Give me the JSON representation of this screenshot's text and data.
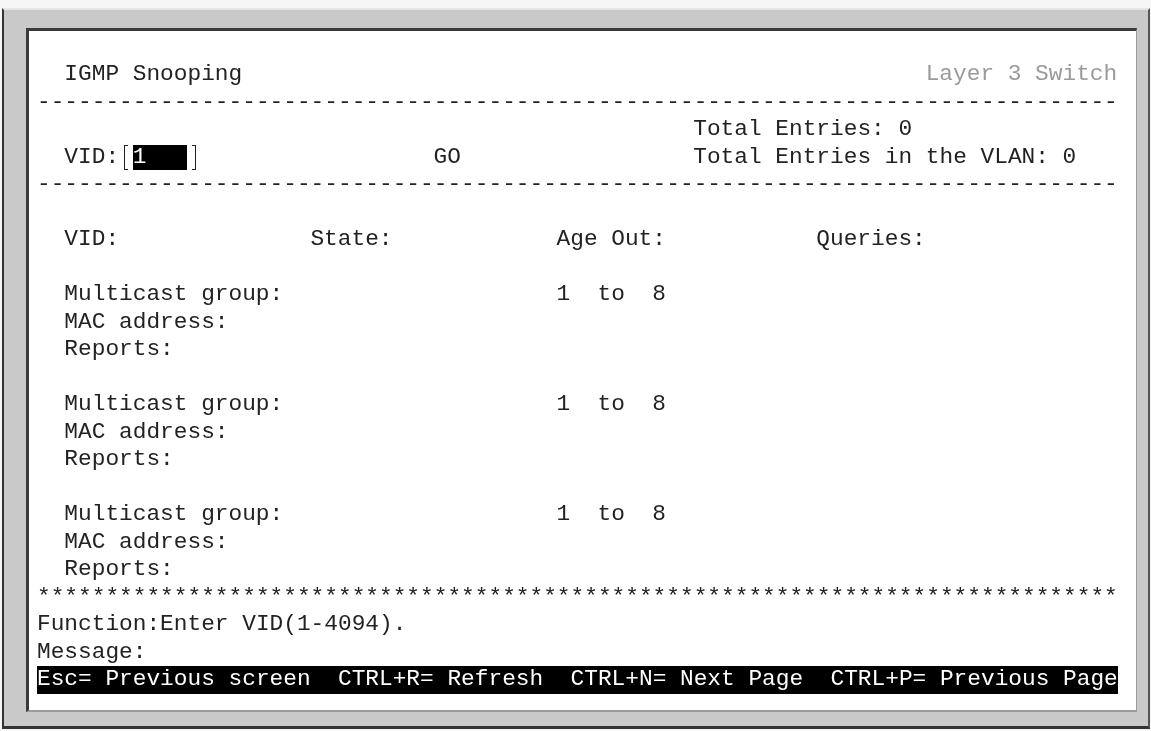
{
  "header": {
    "title": "IGMP Snooping",
    "device": "Layer 3 Switch"
  },
  "rule_top": "-------------------------------------------------------------------------------",
  "totals": [
    "Total Entries: 0",
    "Total Entries in the VLAN: 0"
  ],
  "vid_input": {
    "label": "VID:",
    "value": "1",
    "focused": true
  },
  "go_button": "GO",
  "rule_middle": "-------------------------------------------------------------------------------",
  "columns": [
    "VID:",
    "State:",
    "Age Out:",
    "Queries:"
  ],
  "groups": [
    {
      "group_label": "Multicast group:",
      "range": "1  to  8",
      "mac_label": "MAC address:",
      "reports_label": "Reports:"
    },
    {
      "group_label": "Multicast group:",
      "range": "1  to  8",
      "mac_label": "MAC address:",
      "reports_label": "Reports:"
    },
    {
      "group_label": "Multicast group:",
      "range": "1  to  8",
      "mac_label": "MAC address:",
      "reports_label": "Reports:"
    }
  ],
  "rule_bottom": "*******************************************************************************",
  "function_line": "Function:Enter VID(1-4094).",
  "message_label": "Message:",
  "shortcuts": [
    "Esc= Previous screen",
    "CTRL+R= Refresh",
    "CTRL+N= Next Page",
    "CTRL+P= Previous Page"
  ]
}
